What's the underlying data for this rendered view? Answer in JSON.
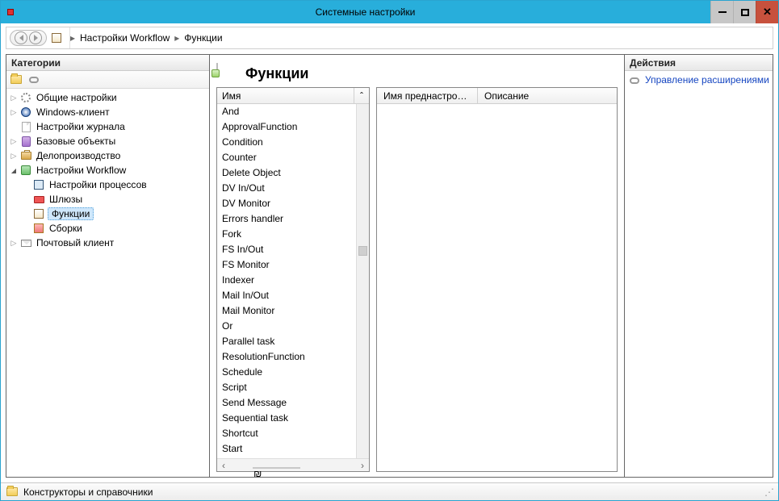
{
  "window": {
    "title": "Системные настройки"
  },
  "breadcrumb": {
    "items": [
      {
        "label": "Настройки Workflow"
      },
      {
        "label": "Функции"
      }
    ]
  },
  "leftPanel": {
    "title": "Категории",
    "tree": [
      {
        "label": "Общие настройки",
        "icon": "gear",
        "expandable": true,
        "expanded": false,
        "depth": 0
      },
      {
        "label": "Windows-клиент",
        "icon": "dv",
        "expandable": true,
        "expanded": false,
        "depth": 0
      },
      {
        "label": "Настройки журнала",
        "icon": "sheet",
        "expandable": false,
        "depth": 0
      },
      {
        "label": "Базовые объекты",
        "icon": "db",
        "expandable": true,
        "expanded": false,
        "depth": 0
      },
      {
        "label": "Делопроизводство",
        "icon": "brief",
        "expandable": true,
        "expanded": false,
        "depth": 0
      },
      {
        "label": "Настройки Workflow",
        "icon": "wf",
        "expandable": true,
        "expanded": true,
        "depth": 0
      },
      {
        "label": "Настройки процессов",
        "icon": "proc",
        "expandable": false,
        "depth": 1
      },
      {
        "label": "Шлюзы",
        "icon": "gate",
        "expandable": false,
        "depth": 1
      },
      {
        "label": "Функции",
        "icon": "func",
        "expandable": false,
        "depth": 1,
        "selected": true
      },
      {
        "label": "Сборки",
        "icon": "asm",
        "expandable": false,
        "depth": 1
      },
      {
        "label": "Почтовый клиент",
        "icon": "mail",
        "expandable": true,
        "expanded": false,
        "depth": 0
      }
    ]
  },
  "main": {
    "title": "Функции",
    "list": {
      "header": "Имя",
      "sortGlyph": "ˆ",
      "items": [
        "And",
        "ApprovalFunction",
        "Condition",
        "Counter",
        "Delete Object",
        "DV In/Out",
        "DV Monitor",
        "Errors handler",
        "Fork",
        "FS In/Out",
        "FS Monitor",
        "Indexer",
        "Mail In/Out",
        "Mail Monitor",
        "Or",
        "Parallel task",
        "ResolutionFunction",
        "Schedule",
        "Script",
        "Send Message",
        "Sequential task",
        "Shortcut",
        "Start"
      ]
    },
    "detail": {
      "col1": "Имя преднастроенн...",
      "col2": "Описание"
    },
    "hscroll": {
      "left": "‹",
      "thumb": "₪",
      "right": "›"
    }
  },
  "rightPanel": {
    "title": "Действия",
    "actions": [
      {
        "label": "Управление расширениями",
        "icon": "chain"
      }
    ]
  },
  "statusbar": {
    "text": "Конструкторы и справочники"
  }
}
